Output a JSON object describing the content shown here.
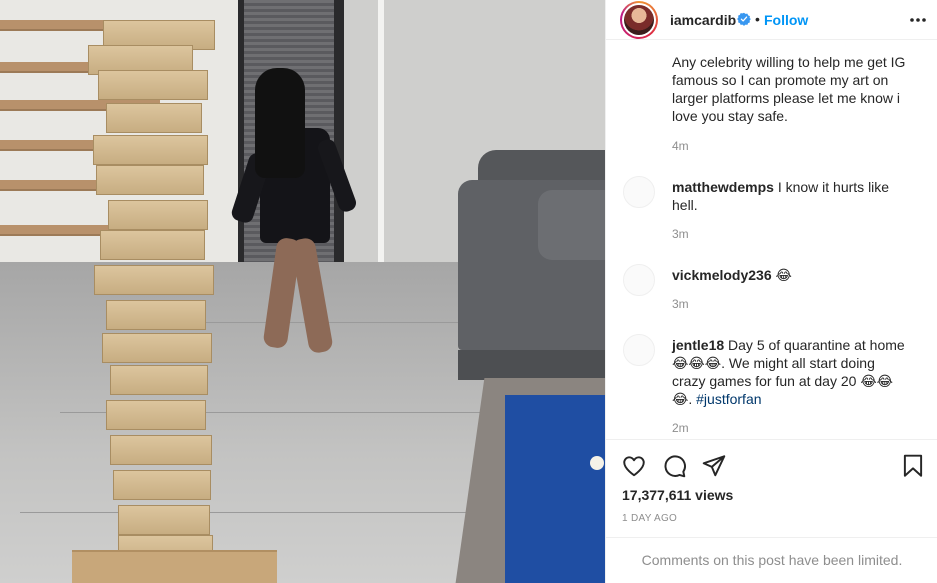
{
  "post": {
    "username": "iamcardib",
    "separator": "•",
    "follow_label": "Follow",
    "views": "17,377,611 views",
    "date": "1 DAY AGO",
    "comments_limited": "Comments on this post have been limited."
  },
  "comments": [
    {
      "user": "",
      "text": "Any celebrity willing to help me get IG famous so I can promote my art on larger platforms please let me know i love you stay safe.",
      "time": "4m"
    },
    {
      "user": "matthewdemps",
      "text": "I know it hurts like hell.",
      "time": "3m"
    },
    {
      "user": "vickmelody236",
      "text": "😂",
      "time": "3m"
    },
    {
      "user": "jentle18",
      "text": "Day 5 of quarantine at home 😂😂😂. We might all start doing crazy games for fun at day 20 😂😂😂.",
      "hashtag": "#justforfan",
      "time": "2m"
    }
  ],
  "icons": {
    "verified": "verified-badge-icon",
    "more": "more-options-icon",
    "like": "heart-icon",
    "comment": "comment-icon",
    "share": "paper-plane-icon",
    "save": "bookmark-icon"
  },
  "colors": {
    "link_blue": "#0095f6",
    "hashtag": "#00376b",
    "muted": "#8e8e8e",
    "text": "#262626"
  }
}
